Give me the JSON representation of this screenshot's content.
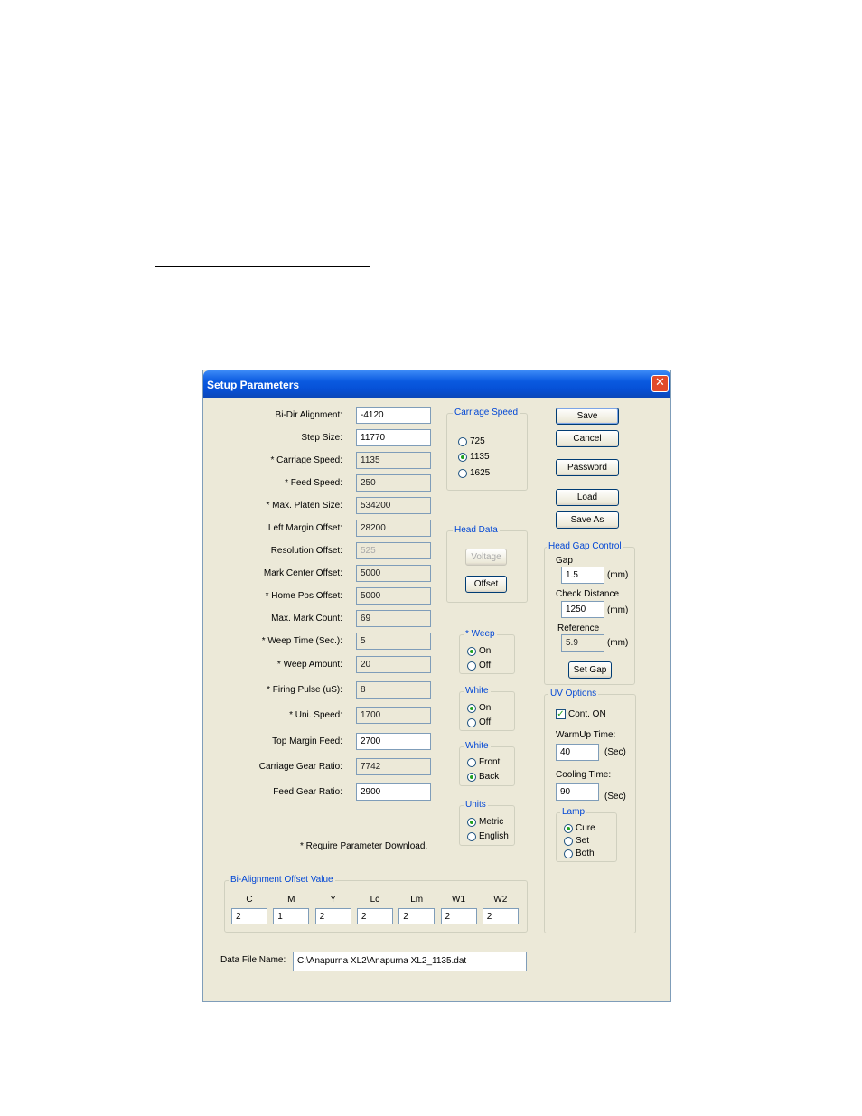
{
  "dialog": {
    "title": "Setup Parameters",
    "close": "✕"
  },
  "params": [
    {
      "label": "Bi-Dir Alignment:",
      "value": "-4120"
    },
    {
      "label": "Step Size:",
      "value": "11770"
    },
    {
      "label": "* Carriage Speed:",
      "value": "1135"
    },
    {
      "label": "* Feed Speed:",
      "value": "250"
    },
    {
      "label": "* Max. Platen Size:",
      "value": "534200"
    },
    {
      "label": "Left Margin Offset:",
      "value": "28200"
    },
    {
      "label": "Resolution Offset:",
      "value": "525"
    },
    {
      "label": "Mark Center Offset:",
      "value": "5000"
    },
    {
      "label": "* Home Pos Offset:",
      "value": "5000"
    },
    {
      "label": "Max. Mark Count:",
      "value": "69"
    },
    {
      "label": "* Weep  Time (Sec.):",
      "value": "5"
    },
    {
      "label": "* Weep Amount:",
      "value": "20"
    },
    {
      "label": "* Firing Pulse (uS):",
      "value": "8"
    },
    {
      "label": "* Uni. Speed:",
      "value": "1700"
    },
    {
      "label": "Top Margin Feed:",
      "value": "2700"
    },
    {
      "label": "Carriage Gear Ratio:",
      "value": "7742"
    },
    {
      "label": "Feed Gear Ratio:",
      "value": "2900"
    }
  ],
  "note": "* Require Parameter Download.",
  "carriage_speed": {
    "title": "Carriage Speed",
    "options": [
      "725",
      "1135",
      "1625"
    ],
    "selected": "1135"
  },
  "head_data": {
    "title": "Head Data",
    "voltage": "Voltage",
    "offset": "Offset"
  },
  "weep": {
    "title": "* Weep",
    "on": "On",
    "off": "Off",
    "selected": "On"
  },
  "white1": {
    "title": "White",
    "on": "On",
    "off": "Off",
    "selected": "On"
  },
  "white2": {
    "title": "White",
    "front": "Front",
    "back": "Back",
    "selected": "Back"
  },
  "units": {
    "title": "Units",
    "metric": "Metric",
    "english": "English",
    "selected": "Metric"
  },
  "buttons": {
    "save": "Save",
    "cancel": "Cancel",
    "password": "Password",
    "load": "Load",
    "save_as": "Save As"
  },
  "head_gap": {
    "title": "Head Gap Control",
    "gap_label": "Gap",
    "gap_value": "1.5",
    "gap_unit": "(mm)",
    "check_label": "Check Distance",
    "check_value": "1250",
    "check_unit": "(mm)",
    "ref_label": "Reference",
    "ref_value": "5.9",
    "ref_unit": "(mm)",
    "set_gap": "Set Gap"
  },
  "uv": {
    "title": "UV Options",
    "cont_on": "Cont. ON",
    "cont_checked": true,
    "warmup_label": "WarmUp Time:",
    "warmup_value": "40",
    "warmup_unit": "(Sec)",
    "cooling_label": "Cooling Time:",
    "cooling_value": "90",
    "cooling_unit": "(Sec)",
    "lamp_title": "Lamp",
    "lamp_cure": "Cure",
    "lamp_set": "Set",
    "lamp_both": "Both",
    "lamp_selected": "Cure"
  },
  "bi_align": {
    "title": "Bi-Alignment Offset Value",
    "columns": [
      {
        "label": "C",
        "value": "2"
      },
      {
        "label": "M",
        "value": "1"
      },
      {
        "label": "Y",
        "value": "2"
      },
      {
        "label": "Lc",
        "value": "2"
      },
      {
        "label": "Lm",
        "value": "2"
      },
      {
        "label": "W1",
        "value": "2"
      },
      {
        "label": "W2",
        "value": "2"
      }
    ]
  },
  "data_file": {
    "label": "Data File Name:",
    "value": "C:\\Anapurna XL2\\Anapurna XL2_1135.dat"
  }
}
